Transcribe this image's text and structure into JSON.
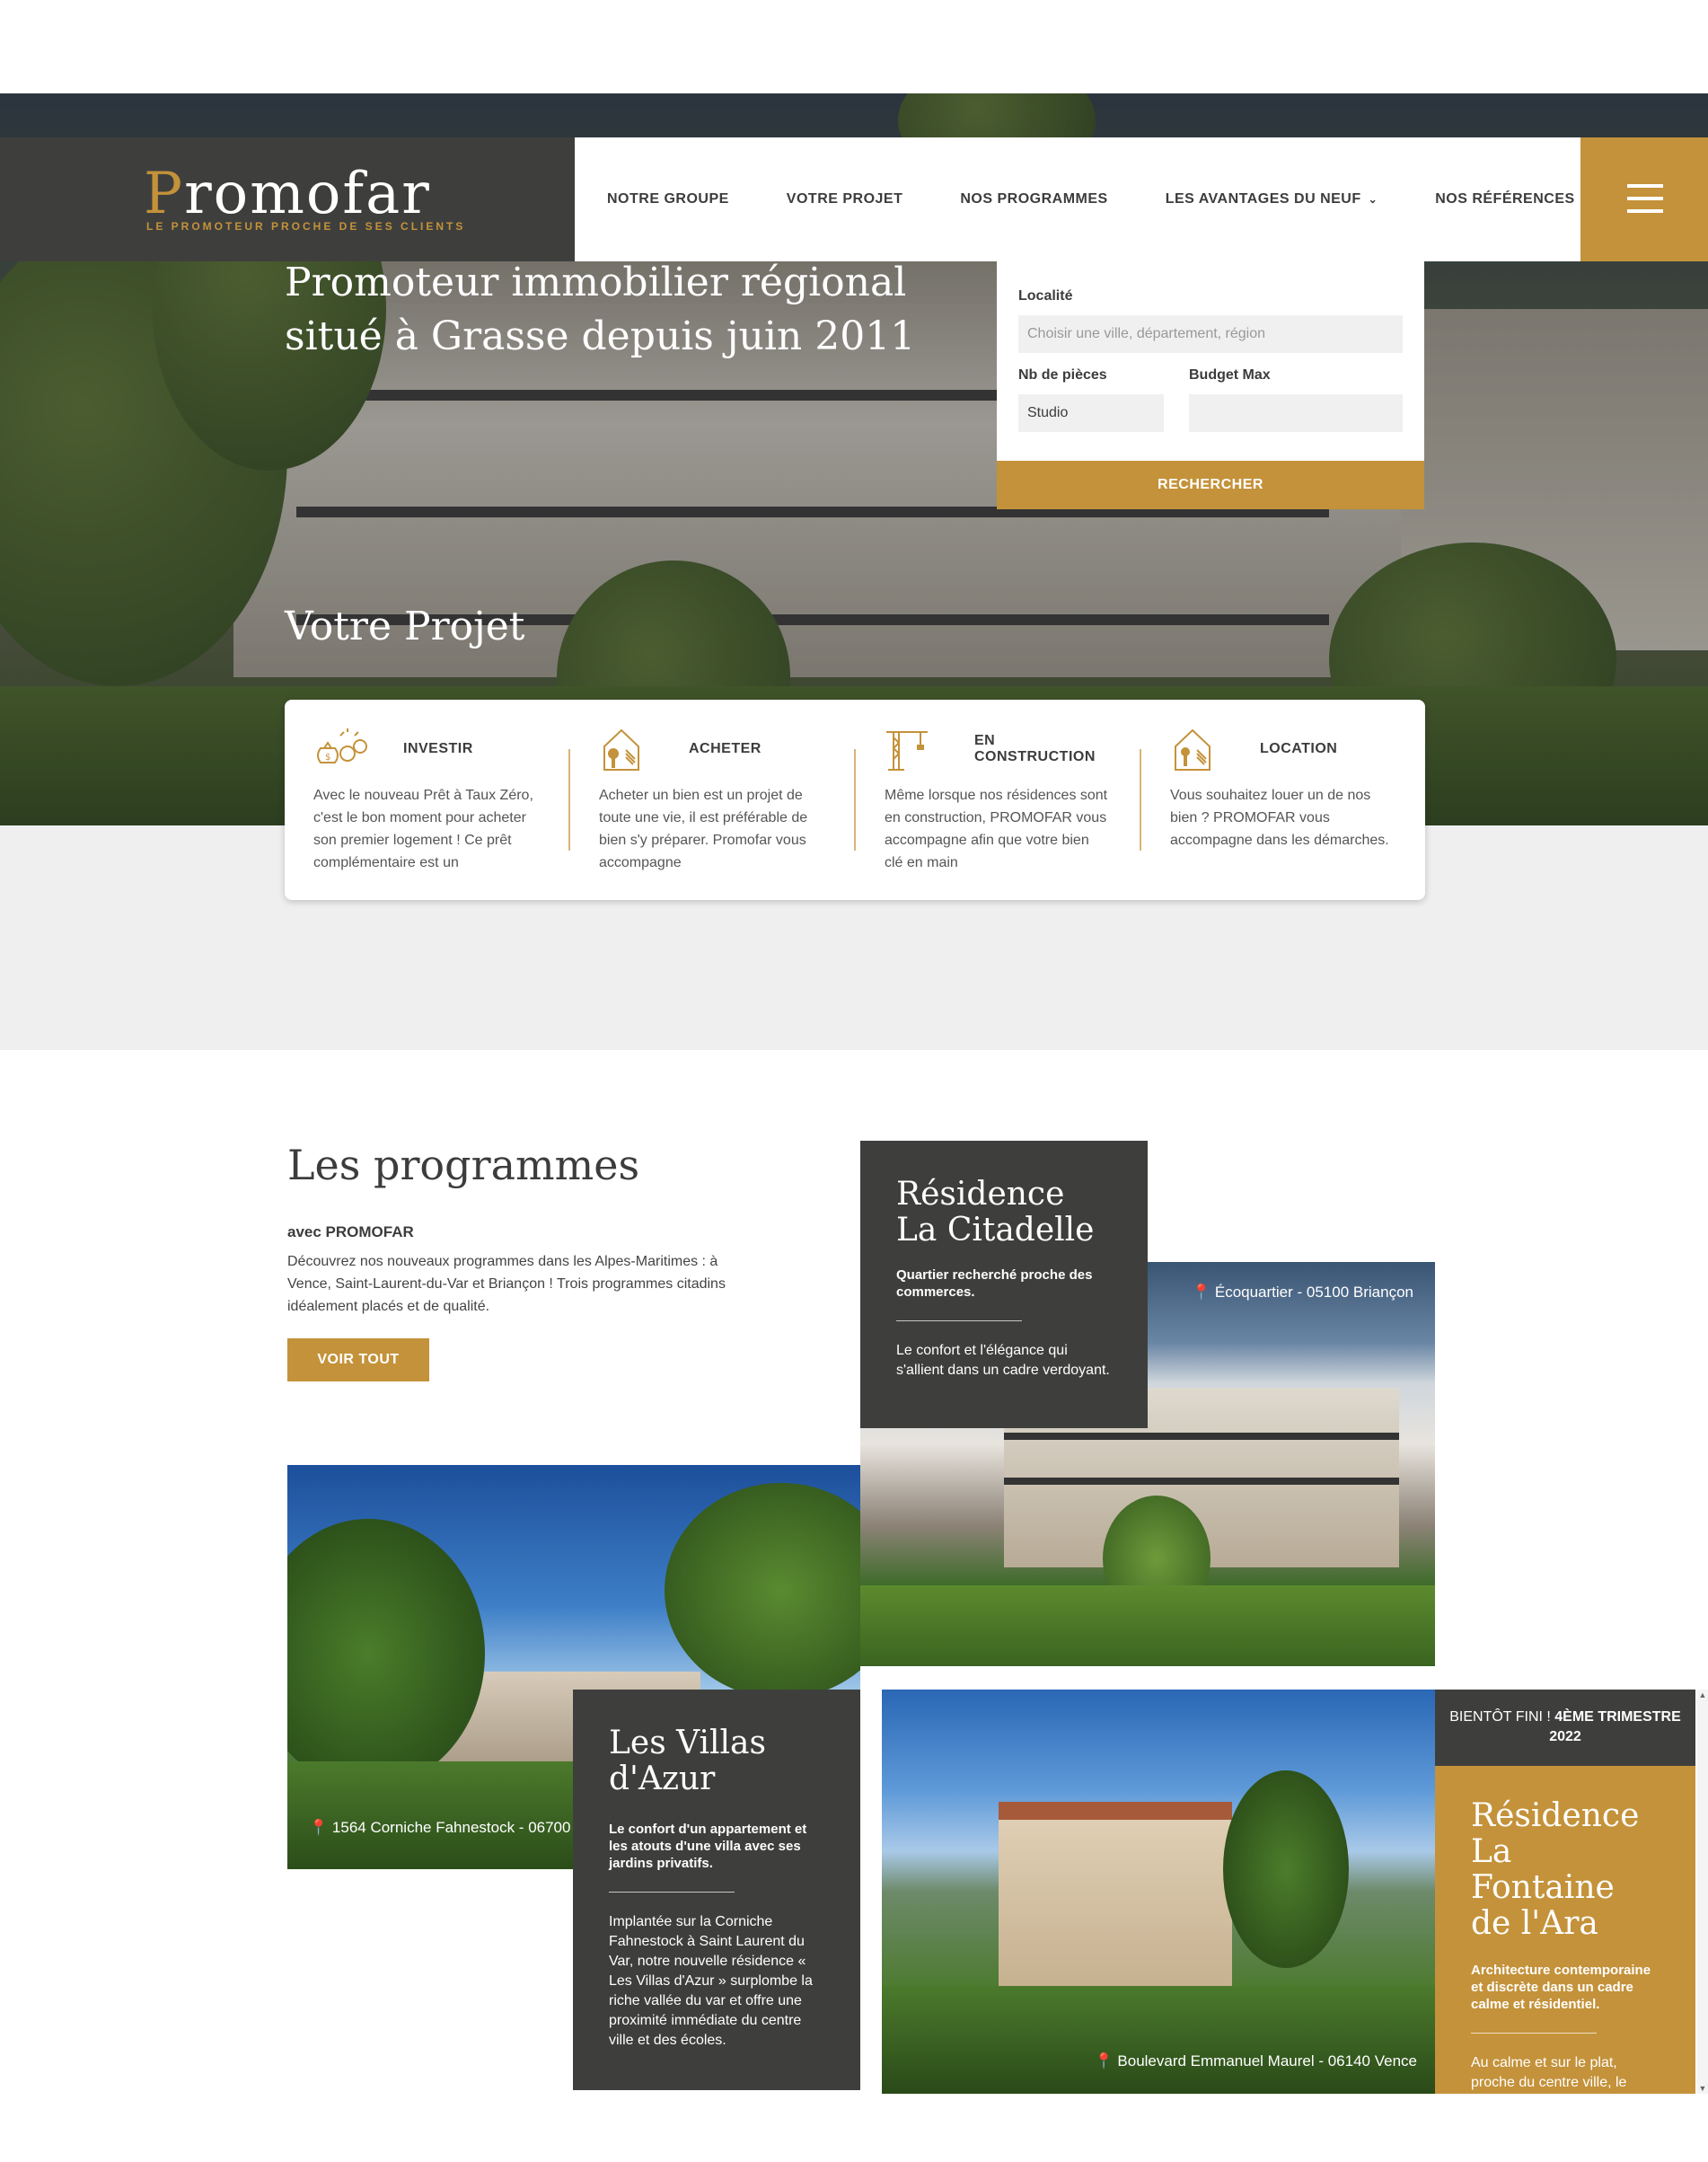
{
  "header": {
    "logo_text_initial": "P",
    "logo_text_rest": "romofar",
    "logo_tagline": "LE PROMOTEUR PROCHE DE SES CLIENTS",
    "nav": [
      "NOTRE GROUPE",
      "VOTRE PROJET",
      "NOS PROGRAMMES",
      "LES AVANTAGES DU NEUF",
      "NOS RÉFÉRENCES"
    ],
    "menu_icon": "hamburger-icon"
  },
  "hero": {
    "title_line1": "Promoteur immobilier régional",
    "title_line2": "situé à Grasse depuis juin 2011"
  },
  "search": {
    "localite_label": "Localité",
    "localite_placeholder": "Choisir une ville, département, région",
    "pieces_label": "Nb de pièces",
    "pieces_value": "Studio",
    "budget_label": "Budget Max",
    "budget_value": "",
    "submit_label": "RECHERCHER"
  },
  "projet": {
    "title": "Votre Projet",
    "cards": [
      {
        "icon": "money-gears-icon",
        "title": "INVESTIR",
        "text": "Avec le nouveau Prêt à Taux Zéro, c'est le bon moment pour acheter son premier logement ! Ce prêt complémentaire est un"
      },
      {
        "icon": "house-key-icon",
        "title": "ACHETER",
        "text": "Acheter un bien est un projet de toute une vie, il est préférable de bien s'y préparer. Promofar vous accompagne"
      },
      {
        "icon": "crane-icon",
        "title": "EN CONSTRUCTION",
        "text": "Même lorsque nos résidences sont en construction, PROMOFAR vous accompagne afin que votre bien clé en main"
      },
      {
        "icon": "house-lock-icon",
        "title": "LOCATION",
        "text": "Vous souhaitez louer un de nos bien ? PROMOFAR vous accompagne dans les démarches."
      }
    ]
  },
  "programmes": {
    "title": "Les programmes",
    "subtitle": "avec PROMOFAR",
    "text": "Découvrez nos nouveaux programmes dans les Alpes-Maritimes : à Vence, Saint-Laurent-du-Var et Briançon ! Trois programmes citadins idéalement placés et de qualité.",
    "button": "VOIR TOUT",
    "items": [
      {
        "name": "Résidence La Citadelle",
        "tagline": "Quartier recherché proche des commerces.",
        "description": "Le confort et l'élégance qui s'allient dans un cadre verdoyant.",
        "address": "Écoquartier - 05100 Briançon"
      },
      {
        "name": "Les Villas d'Azur",
        "tagline": "Le confort d'un appartement et les atouts d'une villa avec ses jardins privatifs.",
        "description": "Implantée sur la Corniche Fahnestock à Saint Laurent du Var, notre nouvelle résidence « Les Villas d'Azur » surplombe la riche vallée du var et offre une proximité immédiate du centre ville et des écoles.",
        "address": "1564 Corniche Fahnestock - 06700"
      },
      {
        "name": "Résidence La Fontaine de l'Ara",
        "tagline": "Architecture contemporaine et discrète dans un cadre calme et résidentiel.",
        "description": "Au calme et sur le plat, proche du centre ville, le quartier résidentiel de",
        "address": "Boulevard Emmanuel Maurel - 06140 Vence",
        "badge_text": "BIENTÔT FINI ! ",
        "badge_bold": "4ÈME TRIMESTRE 2022"
      }
    ]
  },
  "colors": {
    "gold": "#c4923a",
    "dark": "#3e3f3d",
    "grey_band": "#efefef"
  }
}
